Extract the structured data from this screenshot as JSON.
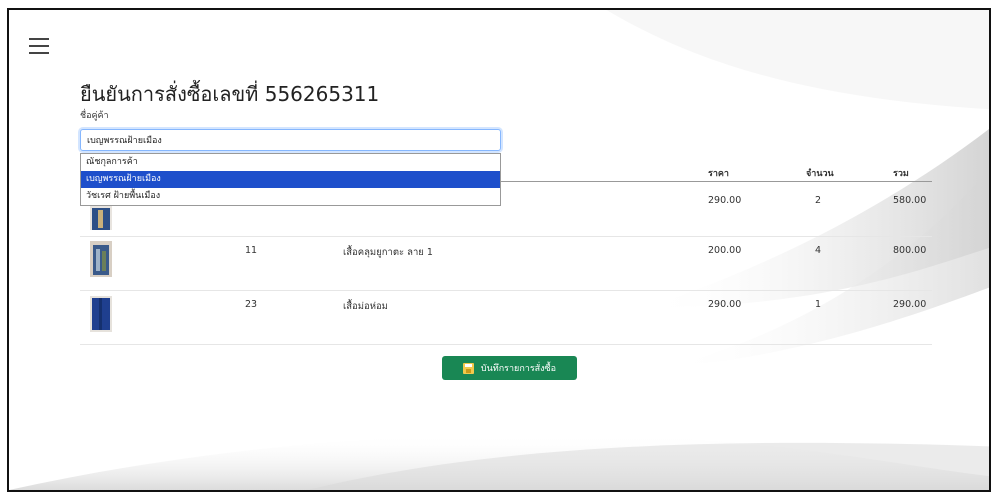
{
  "page": {
    "title": "ยืนยันการสั่งซื้อเลขที่ 556265311",
    "vendor_label": "ชื่อคู่ค้า"
  },
  "vendor_select": {
    "value": "เบญพรรณฝ้ายเมือง",
    "options": [
      {
        "label": "ณัชกุลการค้า",
        "selected": false
      },
      {
        "label": "เบญพรรณฝ้ายเมือง",
        "selected": true
      },
      {
        "label": "วัชเรศ ฝ้ายพื้นเมือง",
        "selected": false
      }
    ]
  },
  "table": {
    "headers": {
      "price": "ราคา",
      "qty": "จำนวน",
      "total": "รวม"
    },
    "rows": [
      {
        "code": "",
        "name": "",
        "price": "290.00",
        "qty": "2",
        "total": "580.00"
      },
      {
        "code": "11",
        "name": "เสื้อคลุมยูกาตะ ลาย 1",
        "price": "200.00",
        "qty": "4",
        "total": "800.00"
      },
      {
        "code": "23",
        "name": "เสื้อม่อห่อม",
        "price": "290.00",
        "qty": "1",
        "total": "290.00"
      }
    ]
  },
  "save_button": {
    "label": "บันทึกรายการสั่งซื้อ",
    "icon": "floppy-disk-icon",
    "color": "#198754"
  },
  "colors": {
    "dropdown_highlight": "#1e4fcb",
    "focus_border": "#86b7fe"
  }
}
